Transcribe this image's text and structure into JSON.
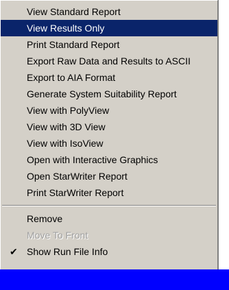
{
  "menu": {
    "items": [
      {
        "label": "View Standard Report"
      },
      {
        "label": "View Results Only"
      },
      {
        "label": "Print Standard Report"
      },
      {
        "label": "Export Raw Data and Results to ASCII"
      },
      {
        "label": "Export to AIA Format"
      },
      {
        "label": "Generate System Suitability Report"
      },
      {
        "label": "View with PolyView"
      },
      {
        "label": "View with 3D View"
      },
      {
        "label": "View with IsoView"
      },
      {
        "label": "Open with Interactive Graphics"
      },
      {
        "label": "Open StarWriter Report"
      },
      {
        "label": "Print StarWriter Report"
      }
    ],
    "remove_label": "Remove",
    "move_to_front_label": "Move To Front",
    "show_run_file_info_label": "Show Run File Info",
    "checkmark": "✔"
  },
  "colors": {
    "menu_bg": "#d4d0c8",
    "highlight": "#0a246a",
    "bottom_bar": "#0000ff"
  }
}
